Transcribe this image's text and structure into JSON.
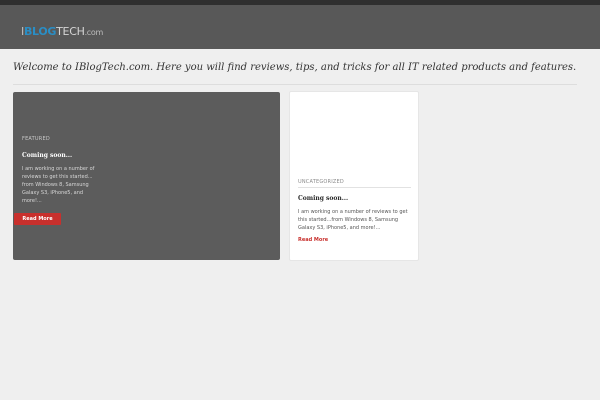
{
  "site": {
    "logo_i": "I",
    "logo_blog": "BLOG",
    "logo_tech": "TECH",
    "logo_com": ".com"
  },
  "intro": {
    "welcome": "Welcome to IBlogTech.com. Here you will find reviews, tips, and tricks for all IT related products and features."
  },
  "featured_post": {
    "category": "FEATURED",
    "title": "Coming soon...",
    "excerpt": "I am working on a number of reviews to get this started... from Windows 8, Samsung Galaxy S3, iPhone5, and more!...",
    "read_more": "Read More"
  },
  "post": {
    "category": "UNCATEGORIZED",
    "title": "Coming soon...",
    "excerpt": "I am working on a number of reviews to get this started...from Windows 8, Samsung Galaxy S3, iPhone5, and more!...",
    "read_more": "Read More"
  },
  "colors": {
    "header_bg": "#585858",
    "accent_blue": "#2a8ec5",
    "accent_red": "#c8302d",
    "page_bg": "#efefef"
  }
}
